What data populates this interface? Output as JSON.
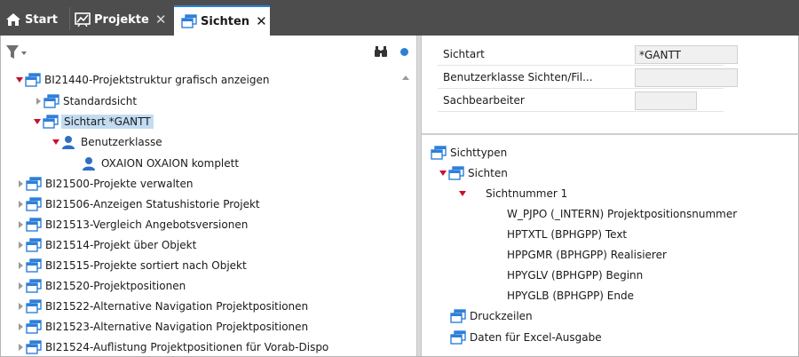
{
  "tabs": [
    {
      "label": "Start",
      "icon": "home-icon"
    },
    {
      "label": "Projekte",
      "icon": "chart-icon",
      "close": "✕"
    },
    {
      "label": "Sichten",
      "icon": "window-icon",
      "close": "✕",
      "active": true
    }
  ],
  "tree": {
    "root": {
      "label": "BI21440-Projektstruktur grafisch anzeigen",
      "expanded": true
    },
    "children": [
      {
        "label": "Standardsicht"
      },
      {
        "label": "Sichtart *GANTT",
        "selected": true
      },
      {
        "label": "Benutzerklasse"
      },
      {
        "label": "OXAION  OXAION komplett"
      }
    ],
    "others": [
      "BI21500-Projekte verwalten",
      "BI21506-Anzeigen Statushistorie Projekt",
      "BI21513-Vergleich Angebotsversionen",
      "BI21514-Projekt über Objekt",
      "BI21515-Projekte sortiert nach Objekt",
      "BI21520-Projektpositionen",
      "BI21522-Alternative Navigation Projektpositionen",
      "BI21523-Alternative Navigation Projektpositionen",
      "BI21524-Auflistung Projektpositionen für Vorab-Dispo"
    ]
  },
  "properties": [
    {
      "label": "Sichtart",
      "value": "*GANTT"
    },
    {
      "label": "Benutzerklasse Sichten/Fil...",
      "value": ""
    },
    {
      "label": "Sachbearbeiter",
      "value": ""
    }
  ],
  "structure": {
    "sichttypen": "Sichttypen",
    "sichten": "Sichten",
    "sichtnummer": "Sichtnummer 1",
    "fields": [
      "W_PJPO (_INTERN) Projektpositionsnummer",
      "HPTXTL (BPHGPP) Text",
      "HPPGMR (BPHGPP) Realisierer",
      "HPYGLV (BPHGPP) Beginn",
      "HPYGLB (BPHGPP) Ende"
    ],
    "druckzeilen": "Druckzeilen",
    "excel": "Daten für Excel-Ausgabe"
  },
  "colors": {
    "accent": "#2e7fd8",
    "tabbar": "#4d4d4d",
    "selection": "#c2dcf2",
    "expand_arrow": "#c8102e"
  }
}
